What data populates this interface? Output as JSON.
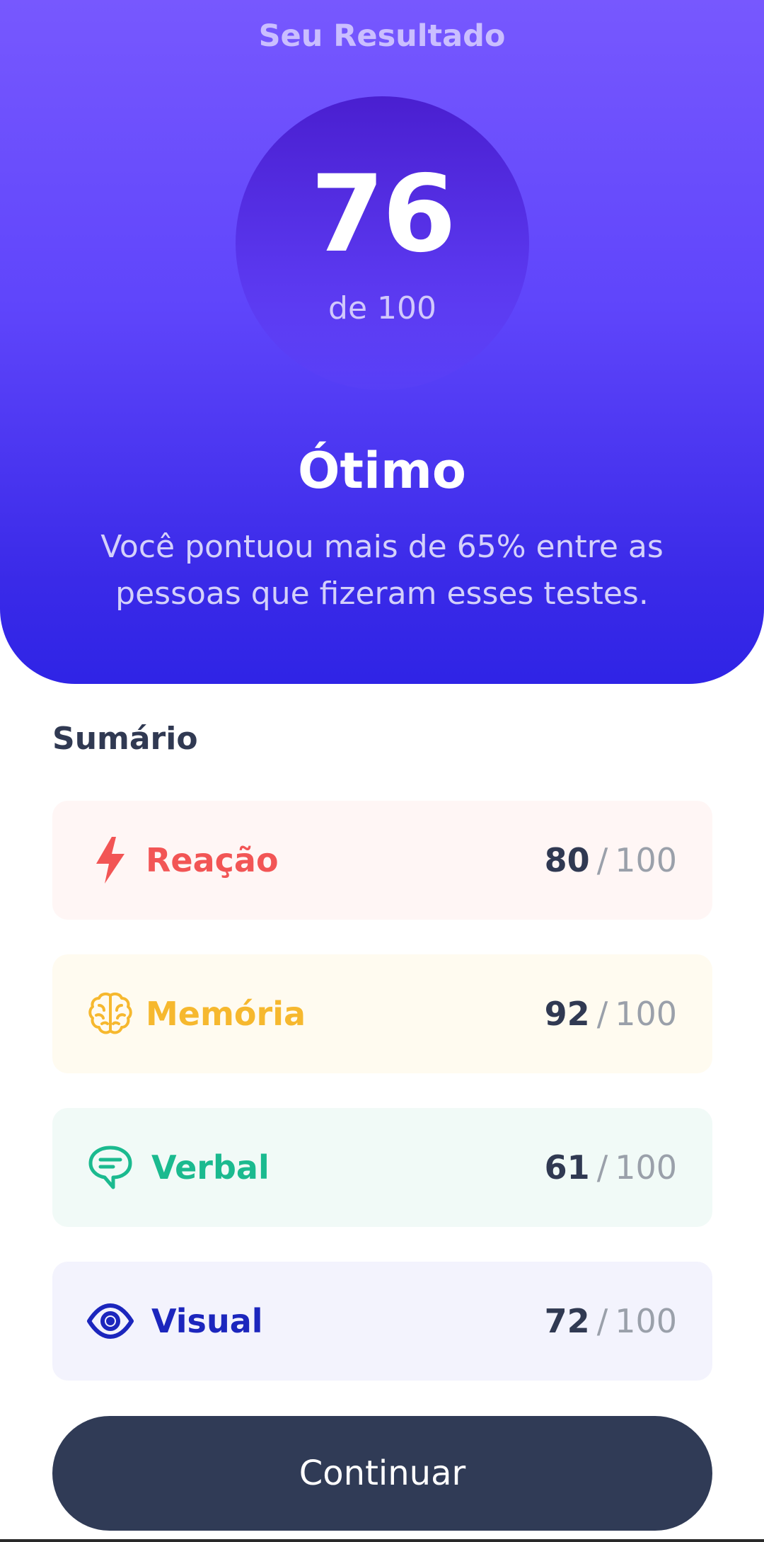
{
  "header": {
    "title": "Seu Resultado"
  },
  "score": {
    "value": "76",
    "max_label": "de 100"
  },
  "rating": {
    "label": "Ótimo",
    "description": "Você pontuou mais de 65% entre as pessoas que fizeram esses testes."
  },
  "summary": {
    "title": "Sumário",
    "items": [
      {
        "label": "Reação",
        "value": "80",
        "separator": "/",
        "max": "100",
        "icon": "lightning-icon",
        "color": "#f25555",
        "bg": "#fff6f5"
      },
      {
        "label": "Memória",
        "value": "92",
        "separator": "/",
        "max": "100",
        "icon": "brain-icon",
        "color": "#f6b82e",
        "bg": "#fffbf0"
      },
      {
        "label": "Verbal",
        "value": "61",
        "separator": "/",
        "max": "100",
        "icon": "chat-icon",
        "color": "#1bba8f",
        "bg": "#f1faf7"
      },
      {
        "label": "Visual",
        "value": "72",
        "separator": "/",
        "max": "100",
        "icon": "eye-icon",
        "color": "#1c26bd",
        "bg": "#f3f3fd"
      }
    ]
  },
  "actions": {
    "continue_label": "Continuar"
  },
  "colors": {
    "hero_top": "#7758fe",
    "hero_bottom": "#2f24e6",
    "text_dark": "#303952",
    "button_bg": "#303b56"
  }
}
